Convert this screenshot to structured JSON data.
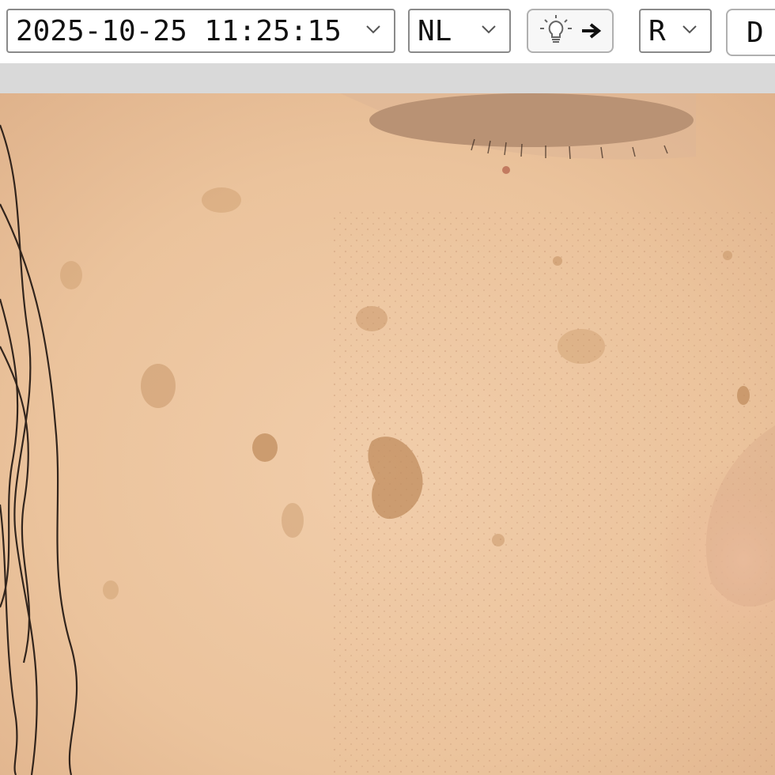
{
  "toolbar": {
    "datetime_select": {
      "value": "2025-10-25 11:25:15"
    },
    "mode_select": {
      "value": "NL"
    },
    "light_button": {
      "icon": "lightbulb-icon",
      "arrow": "arrow-right-icon"
    },
    "side_select": {
      "value": "R"
    },
    "view_button": {
      "label": "D"
    }
  },
  "photo": {
    "description_icon": "skin-photo",
    "skin_color": "#e9c39e",
    "privacy_mask_color": "#b99274"
  }
}
